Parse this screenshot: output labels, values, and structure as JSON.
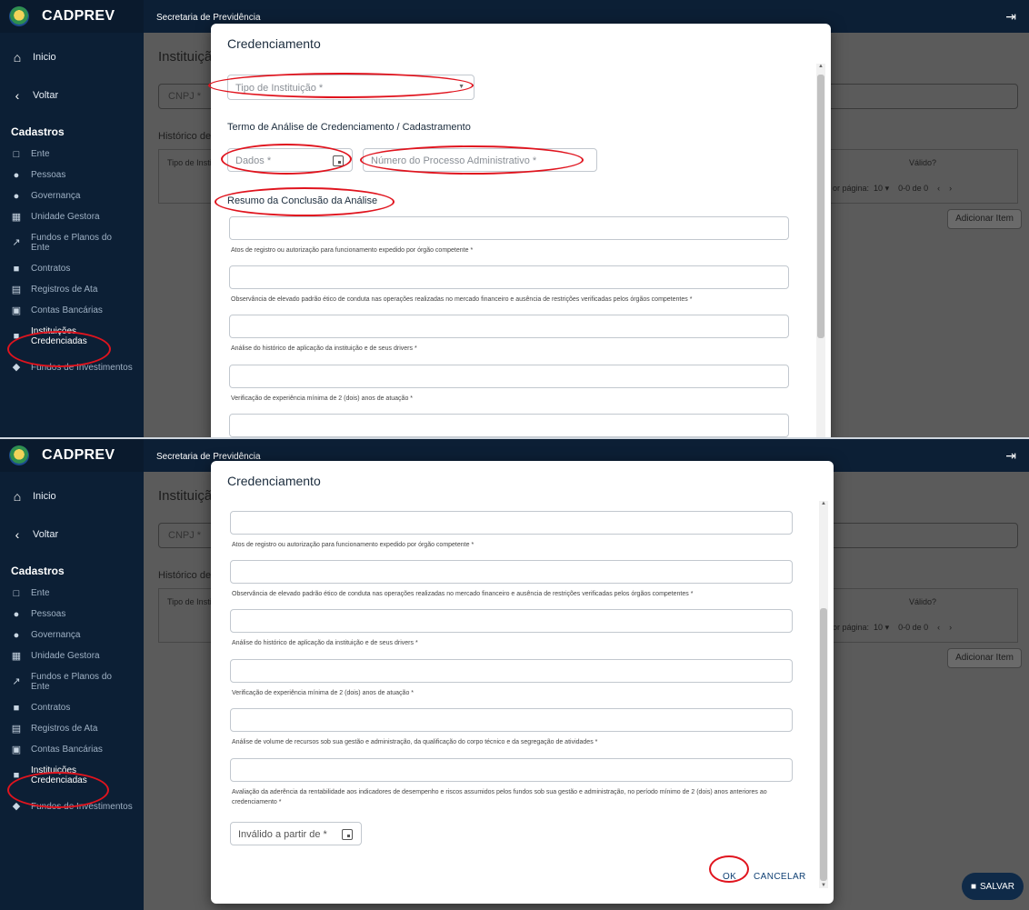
{
  "app": {
    "brand": "CADPREV",
    "topbar_text": "Secretaria de Previdência",
    "nav": [
      {
        "label": "Inicio",
        "icon": "home-icon"
      },
      {
        "label": "Voltar",
        "icon": "chevron-left-icon"
      }
    ],
    "section": "Cadastros",
    "items": [
      {
        "label": "Ente",
        "icon": "bank-icon"
      },
      {
        "label": "Pessoas",
        "icon": "person-icon"
      },
      {
        "label": "Governança",
        "icon": "group-icon"
      },
      {
        "label": "Unidade Gestora",
        "icon": "building-icon"
      },
      {
        "label": "Fundos e Planos do Ente",
        "icon": "trend-icon"
      },
      {
        "label": "Contratos",
        "icon": "document-icon"
      },
      {
        "label": "Registros de Ata",
        "icon": "list-icon"
      },
      {
        "label": "Contas Bancárias",
        "icon": "bank-card-icon"
      },
      {
        "label": "Instituições Credenciadas",
        "icon": "badge-icon"
      },
      {
        "label": "Fundos de Investimentos",
        "icon": "shield-icon"
      }
    ]
  },
  "main": {
    "page_title": "Instituição",
    "cnpj_placeholder": "CNPJ *",
    "history_title": "Histórico de",
    "col_tipo": "Tipo de Insti",
    "col_valido": "Válido?",
    "rows_per_page_label": "or página:",
    "rows_per_page_value": "10",
    "range": "0-0 de 0",
    "add_item": "Adicionar Item",
    "salvar": "SALVAR"
  },
  "modal": {
    "title": "Credenciamento",
    "tipo_instituicao": "Tipo de Instituição *",
    "termo_title": "Termo de Análise de Credenciamento / Cadastramento",
    "dados": "Dados *",
    "numero_processo": "Número do Processo Administrativo *",
    "resumo_title": "Resumo da Conclusão da Análise",
    "fields": [
      "Atos de registro ou autorização para funcionamento expedido por órgão competente *",
      "Observância de elevado padrão ético de conduta nas operações realizadas no mercado financeiro e ausência de restrições verificadas pelos órgãos competentes *",
      "Análise do histórico de aplicação da instituição e de seus drivers *",
      "Verificação de experiência mínima de 2 (dois) anos de atuação *",
      "Análise de volume de recursos sob sua gestão e administração, da qualificação do corpo técnico e da segregação de atividades *",
      "Avaliação da aderência da rentabilidade aos indicadores de desempenho e riscos assumidos pelos fundos sob sua gestão e administração, no período mínimo de 2 (dois) anos anteriores ao credenciamento *"
    ],
    "invalido": "Inválido a partir de *",
    "ok": "OK",
    "cancelar": "CANCELAR"
  }
}
